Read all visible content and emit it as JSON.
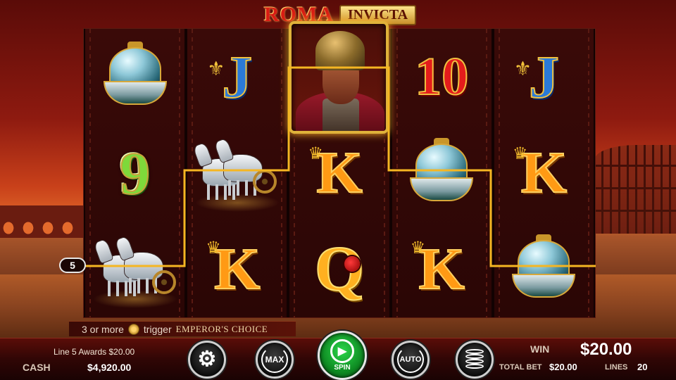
{
  "title": {
    "main": "ROMA",
    "badge": "INVICTA"
  },
  "reels": [
    [
      "helmet",
      "9",
      "chariot"
    ],
    [
      "J",
      "chariot",
      "K"
    ],
    [
      "emperor",
      "K",
      "Q"
    ],
    [
      "10",
      "helmet",
      "K"
    ],
    [
      "J",
      "K",
      "helmet"
    ]
  ],
  "payline": {
    "number": "5",
    "color": "#f5b622"
  },
  "trigger": {
    "prefix": "3 or more",
    "word": "trigger",
    "feature": "EMPEROR'S CHOICE"
  },
  "status": {
    "award": "Line 5 Awards $20.00",
    "cash_label": "CASH",
    "cash_value": "$4,920.00",
    "win_label": "WIN",
    "win_value": "$20.00",
    "total_bet_label": "TOTAL BET",
    "total_bet_value": "$20.00",
    "lines_label": "LINES",
    "lines_value": "20"
  },
  "controls": {
    "settings_icon": "gear-icon",
    "max_label": "MAX",
    "spin_label": "SPIN",
    "auto_label": "AUTO",
    "coins_icon": "coin-stack-icon"
  },
  "colors": {
    "accent_gold": "#e0b23a",
    "spin_green": "#1fb83a",
    "background_red": "#8e1a10"
  }
}
